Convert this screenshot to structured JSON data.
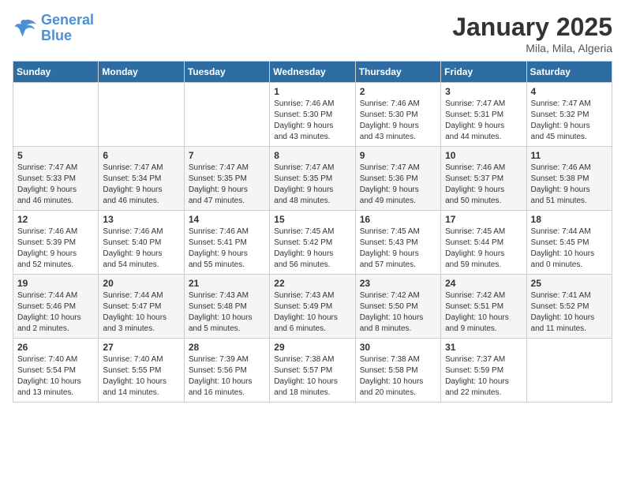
{
  "header": {
    "logo_line1": "General",
    "logo_line2": "Blue",
    "month": "January 2025",
    "location": "Mila, Mila, Algeria"
  },
  "days_of_week": [
    "Sunday",
    "Monday",
    "Tuesday",
    "Wednesday",
    "Thursday",
    "Friday",
    "Saturday"
  ],
  "weeks": [
    [
      {
        "day": "",
        "info": ""
      },
      {
        "day": "",
        "info": ""
      },
      {
        "day": "",
        "info": ""
      },
      {
        "day": "1",
        "info": "Sunrise: 7:46 AM\nSunset: 5:30 PM\nDaylight: 9 hours\nand 43 minutes."
      },
      {
        "day": "2",
        "info": "Sunrise: 7:46 AM\nSunset: 5:30 PM\nDaylight: 9 hours\nand 43 minutes."
      },
      {
        "day": "3",
        "info": "Sunrise: 7:47 AM\nSunset: 5:31 PM\nDaylight: 9 hours\nand 44 minutes."
      },
      {
        "day": "4",
        "info": "Sunrise: 7:47 AM\nSunset: 5:32 PM\nDaylight: 9 hours\nand 45 minutes."
      }
    ],
    [
      {
        "day": "5",
        "info": "Sunrise: 7:47 AM\nSunset: 5:33 PM\nDaylight: 9 hours\nand 46 minutes."
      },
      {
        "day": "6",
        "info": "Sunrise: 7:47 AM\nSunset: 5:34 PM\nDaylight: 9 hours\nand 46 minutes."
      },
      {
        "day": "7",
        "info": "Sunrise: 7:47 AM\nSunset: 5:35 PM\nDaylight: 9 hours\nand 47 minutes."
      },
      {
        "day": "8",
        "info": "Sunrise: 7:47 AM\nSunset: 5:35 PM\nDaylight: 9 hours\nand 48 minutes."
      },
      {
        "day": "9",
        "info": "Sunrise: 7:47 AM\nSunset: 5:36 PM\nDaylight: 9 hours\nand 49 minutes."
      },
      {
        "day": "10",
        "info": "Sunrise: 7:46 AM\nSunset: 5:37 PM\nDaylight: 9 hours\nand 50 minutes."
      },
      {
        "day": "11",
        "info": "Sunrise: 7:46 AM\nSunset: 5:38 PM\nDaylight: 9 hours\nand 51 minutes."
      }
    ],
    [
      {
        "day": "12",
        "info": "Sunrise: 7:46 AM\nSunset: 5:39 PM\nDaylight: 9 hours\nand 52 minutes."
      },
      {
        "day": "13",
        "info": "Sunrise: 7:46 AM\nSunset: 5:40 PM\nDaylight: 9 hours\nand 54 minutes."
      },
      {
        "day": "14",
        "info": "Sunrise: 7:46 AM\nSunset: 5:41 PM\nDaylight: 9 hours\nand 55 minutes."
      },
      {
        "day": "15",
        "info": "Sunrise: 7:45 AM\nSunset: 5:42 PM\nDaylight: 9 hours\nand 56 minutes."
      },
      {
        "day": "16",
        "info": "Sunrise: 7:45 AM\nSunset: 5:43 PM\nDaylight: 9 hours\nand 57 minutes."
      },
      {
        "day": "17",
        "info": "Sunrise: 7:45 AM\nSunset: 5:44 PM\nDaylight: 9 hours\nand 59 minutes."
      },
      {
        "day": "18",
        "info": "Sunrise: 7:44 AM\nSunset: 5:45 PM\nDaylight: 10 hours\nand 0 minutes."
      }
    ],
    [
      {
        "day": "19",
        "info": "Sunrise: 7:44 AM\nSunset: 5:46 PM\nDaylight: 10 hours\nand 2 minutes."
      },
      {
        "day": "20",
        "info": "Sunrise: 7:44 AM\nSunset: 5:47 PM\nDaylight: 10 hours\nand 3 minutes."
      },
      {
        "day": "21",
        "info": "Sunrise: 7:43 AM\nSunset: 5:48 PM\nDaylight: 10 hours\nand 5 minutes."
      },
      {
        "day": "22",
        "info": "Sunrise: 7:43 AM\nSunset: 5:49 PM\nDaylight: 10 hours\nand 6 minutes."
      },
      {
        "day": "23",
        "info": "Sunrise: 7:42 AM\nSunset: 5:50 PM\nDaylight: 10 hours\nand 8 minutes."
      },
      {
        "day": "24",
        "info": "Sunrise: 7:42 AM\nSunset: 5:51 PM\nDaylight: 10 hours\nand 9 minutes."
      },
      {
        "day": "25",
        "info": "Sunrise: 7:41 AM\nSunset: 5:52 PM\nDaylight: 10 hours\nand 11 minutes."
      }
    ],
    [
      {
        "day": "26",
        "info": "Sunrise: 7:40 AM\nSunset: 5:54 PM\nDaylight: 10 hours\nand 13 minutes."
      },
      {
        "day": "27",
        "info": "Sunrise: 7:40 AM\nSunset: 5:55 PM\nDaylight: 10 hours\nand 14 minutes."
      },
      {
        "day": "28",
        "info": "Sunrise: 7:39 AM\nSunset: 5:56 PM\nDaylight: 10 hours\nand 16 minutes."
      },
      {
        "day": "29",
        "info": "Sunrise: 7:38 AM\nSunset: 5:57 PM\nDaylight: 10 hours\nand 18 minutes."
      },
      {
        "day": "30",
        "info": "Sunrise: 7:38 AM\nSunset: 5:58 PM\nDaylight: 10 hours\nand 20 minutes."
      },
      {
        "day": "31",
        "info": "Sunrise: 7:37 AM\nSunset: 5:59 PM\nDaylight: 10 hours\nand 22 minutes."
      },
      {
        "day": "",
        "info": ""
      }
    ]
  ]
}
